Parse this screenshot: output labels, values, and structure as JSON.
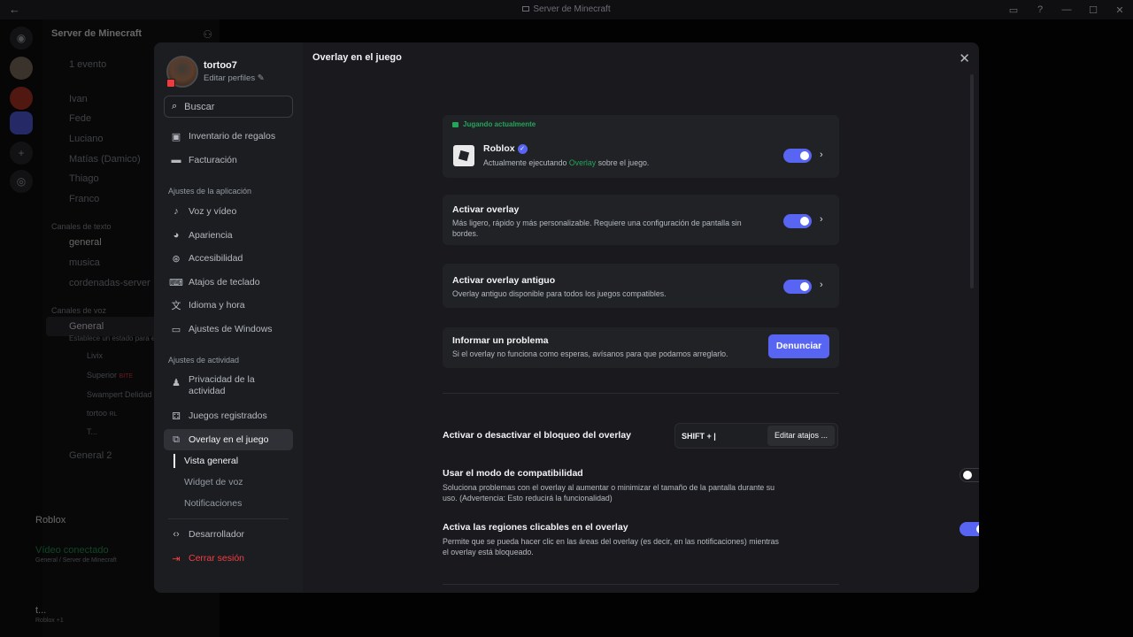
{
  "window": {
    "title": "Server de Minecraft"
  },
  "background": {
    "server_name": "Server de Minecraft",
    "channels": [
      "1 evento",
      "Ivan",
      "Fede",
      "Luciano",
      "Matías (Damico)",
      "Thiago",
      "Franco"
    ],
    "text_category": "Canales de texto",
    "text_channels": [
      "general",
      "musica",
      "cordenadas-server"
    ],
    "voice_category": "Canales de voz",
    "voice_channel": "General",
    "voice_hint": "Establece un estado para el",
    "voice_users": [
      "Livix",
      "Superior",
      "Swampert Delidad",
      "tortoo",
      "T..."
    ],
    "voice_badge_1": "BITE",
    "voice_badge_2": "RL",
    "voice_channel_2": "General 2",
    "activity_game": "Roblox",
    "voice_connected": "Vídeo conectado",
    "voice_connected_sub": "General / Server de Minecraft",
    "user_name": "t...",
    "user_status": "Roblox +1"
  },
  "sidebar": {
    "username": "tortoo7",
    "edit_profiles": "Editar perfiles",
    "search_placeholder": "Buscar",
    "items_top": [
      {
        "label": "Inventario de regalos",
        "icon": "gift-icon"
      },
      {
        "label": "Facturación",
        "icon": "card-icon"
      }
    ],
    "app_settings_label": "Ajustes de la aplicación",
    "app_items": [
      {
        "label": "Voz y vídeo",
        "icon": "mic-icon"
      },
      {
        "label": "Apariencia",
        "icon": "palette-icon"
      },
      {
        "label": "Accesibilidad",
        "icon": "accessibility-icon"
      },
      {
        "label": "Atajos de teclado",
        "icon": "keyboard-icon"
      },
      {
        "label": "Idioma y hora",
        "icon": "language-icon"
      },
      {
        "label": "Ajustes de Windows",
        "icon": "monitor-icon"
      }
    ],
    "activity_settings_label": "Ajustes de actividad",
    "activity_items": [
      {
        "label": "Privacidad de la actividad",
        "icon": "privacy-icon"
      },
      {
        "label": "Juegos registrados",
        "icon": "gamepad-icon"
      },
      {
        "label": "Overlay en el juego",
        "icon": "overlay-icon"
      }
    ],
    "sub_items": [
      "Vista general",
      "Widget de voz",
      "Notificaciones"
    ],
    "developer": "Desarrollador",
    "logout": "Cerrar sesión"
  },
  "main": {
    "title": "Overlay en el juego",
    "now_playing": {
      "header": "Jugando actualmente",
      "game": "Roblox",
      "desc_prefix": "Actualmente ejecutando",
      "desc_highlight": "Overlay",
      "desc_suffix": "sobre el juego.",
      "enabled": true
    },
    "enable_overlay": {
      "title": "Activar overlay",
      "desc": "Más ligero, rápido y más personalizable. Requiere una configuración de pantalla sin bordes.",
      "enabled": true
    },
    "legacy_overlay": {
      "title": "Activar overlay antiguo",
      "desc": "Overlay antiguo disponible para todos los juegos compatibles.",
      "enabled": true
    },
    "report": {
      "title": "Informar un problema",
      "desc": "Si el overlay no funciona como esperas, avísanos para que podamos arreglarlo.",
      "button": "Denunciar"
    },
    "lock_toggle": {
      "title": "Activar o desactivar el bloqueo del overlay",
      "keybind": "SHIFT + |",
      "edit_button": "Editar atajos ..."
    },
    "compat_mode": {
      "title": "Usar el modo de compatibilidad",
      "desc": "Soluciona problemas con el overlay al aumentar o minimizar el tamaño de la pantalla durante su uso. (Advertencia: Esto reducirá la funcionalidad)",
      "enabled": false
    },
    "clickable_regions": {
      "title": "Activa las regiones clicables en el overlay",
      "desc": "Permite que se pueda hacer clic en las áreas del overlay (es decir, en las notificaciones) mientras el overlay está bloqueado.",
      "enabled": true
    }
  },
  "colors": {
    "accent": "#5865f2",
    "green": "#23a55a",
    "danger": "#f23f43"
  }
}
